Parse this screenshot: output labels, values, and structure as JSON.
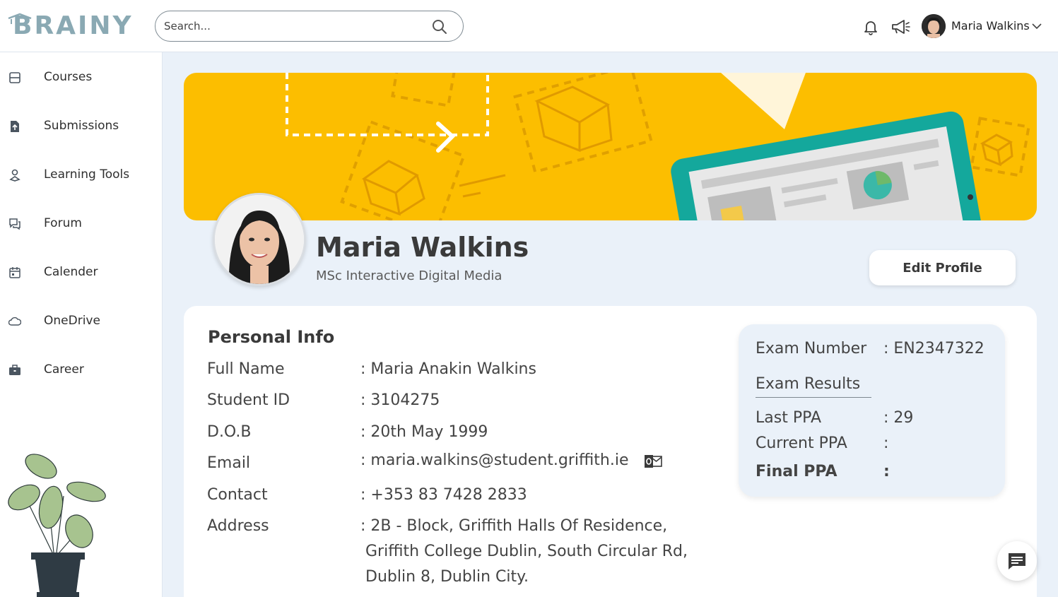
{
  "app": {
    "logo_text": "BRAINY"
  },
  "header": {
    "search_placeholder": "Search...",
    "user_name": "Maria Walkins",
    "icons": [
      "bell-icon",
      "megaphone-icon",
      "chevron-down-icon",
      "search-icon"
    ]
  },
  "sidebar": {
    "items": [
      {
        "label": "Courses",
        "icon": "courses-icon"
      },
      {
        "label": "Submissions",
        "icon": "submissions-icon"
      },
      {
        "label": "Learning Tools",
        "icon": "learning-tools-icon"
      },
      {
        "label": "Forum",
        "icon": "forum-icon"
      },
      {
        "label": "Calender",
        "icon": "calendar-icon"
      },
      {
        "label": "OneDrive",
        "icon": "cloud-icon"
      },
      {
        "label": "Career",
        "icon": "briefcase-icon"
      }
    ]
  },
  "profile": {
    "name": "Maria Walkins",
    "programme": "MSc Interactive Digital Media",
    "edit_label": "Edit Profile"
  },
  "personal_info": {
    "title": "Personal Info",
    "rows": [
      {
        "label": "Full Name",
        "value": ": Maria Anakin Walkins"
      },
      {
        "label": "Student ID",
        "value": ": 3104275"
      },
      {
        "label": "D.O.B",
        "value": ": 20th May 1999"
      },
      {
        "label": "Email",
        "value": ": maria.walkins@student.griffith.ie"
      },
      {
        "label": "Contact",
        "value": ": +353 83 7428 2833"
      },
      {
        "label": "Address",
        "value": ": 2B - Block, Griffith Halls Of Residence,"
      }
    ],
    "address_lines": [
      "Griffith College Dublin, South Circular Rd,",
      "Dublin 8, Dublin City."
    ]
  },
  "exam": {
    "number_label": "Exam Number",
    "number_value": ": EN2347322",
    "results_title": "Exam Results",
    "results": [
      {
        "label": "Last PPA",
        "value": ": 29"
      },
      {
        "label": "Current PPA",
        "value": ":"
      },
      {
        "label": "Final PPA",
        "value": ":"
      }
    ]
  },
  "colors": {
    "banner": "#fcbe00",
    "accent": "#1aa59a",
    "background": "#eaf1f9"
  }
}
